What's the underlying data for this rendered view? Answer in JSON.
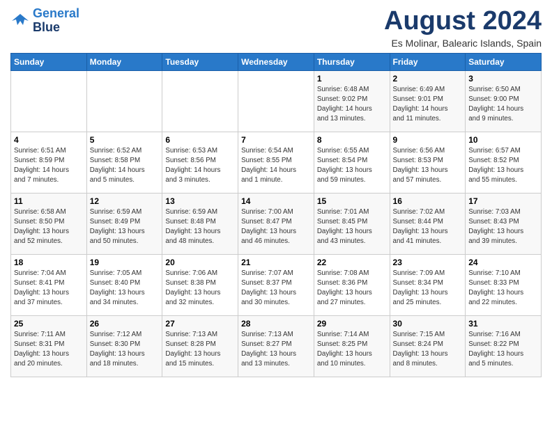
{
  "header": {
    "logo_line1": "General",
    "logo_line2": "Blue",
    "month": "August 2024",
    "location": "Es Molinar, Balearic Islands, Spain"
  },
  "days_of_week": [
    "Sunday",
    "Monday",
    "Tuesday",
    "Wednesday",
    "Thursday",
    "Friday",
    "Saturday"
  ],
  "weeks": [
    [
      {
        "day": "",
        "info": ""
      },
      {
        "day": "",
        "info": ""
      },
      {
        "day": "",
        "info": ""
      },
      {
        "day": "",
        "info": ""
      },
      {
        "day": "1",
        "info": "Sunrise: 6:48 AM\nSunset: 9:02 PM\nDaylight: 14 hours\nand 13 minutes."
      },
      {
        "day": "2",
        "info": "Sunrise: 6:49 AM\nSunset: 9:01 PM\nDaylight: 14 hours\nand 11 minutes."
      },
      {
        "day": "3",
        "info": "Sunrise: 6:50 AM\nSunset: 9:00 PM\nDaylight: 14 hours\nand 9 minutes."
      }
    ],
    [
      {
        "day": "4",
        "info": "Sunrise: 6:51 AM\nSunset: 8:59 PM\nDaylight: 14 hours\nand 7 minutes."
      },
      {
        "day": "5",
        "info": "Sunrise: 6:52 AM\nSunset: 8:58 PM\nDaylight: 14 hours\nand 5 minutes."
      },
      {
        "day": "6",
        "info": "Sunrise: 6:53 AM\nSunset: 8:56 PM\nDaylight: 14 hours\nand 3 minutes."
      },
      {
        "day": "7",
        "info": "Sunrise: 6:54 AM\nSunset: 8:55 PM\nDaylight: 14 hours\nand 1 minute."
      },
      {
        "day": "8",
        "info": "Sunrise: 6:55 AM\nSunset: 8:54 PM\nDaylight: 13 hours\nand 59 minutes."
      },
      {
        "day": "9",
        "info": "Sunrise: 6:56 AM\nSunset: 8:53 PM\nDaylight: 13 hours\nand 57 minutes."
      },
      {
        "day": "10",
        "info": "Sunrise: 6:57 AM\nSunset: 8:52 PM\nDaylight: 13 hours\nand 55 minutes."
      }
    ],
    [
      {
        "day": "11",
        "info": "Sunrise: 6:58 AM\nSunset: 8:50 PM\nDaylight: 13 hours\nand 52 minutes."
      },
      {
        "day": "12",
        "info": "Sunrise: 6:59 AM\nSunset: 8:49 PM\nDaylight: 13 hours\nand 50 minutes."
      },
      {
        "day": "13",
        "info": "Sunrise: 6:59 AM\nSunset: 8:48 PM\nDaylight: 13 hours\nand 48 minutes."
      },
      {
        "day": "14",
        "info": "Sunrise: 7:00 AM\nSunset: 8:47 PM\nDaylight: 13 hours\nand 46 minutes."
      },
      {
        "day": "15",
        "info": "Sunrise: 7:01 AM\nSunset: 8:45 PM\nDaylight: 13 hours\nand 43 minutes."
      },
      {
        "day": "16",
        "info": "Sunrise: 7:02 AM\nSunset: 8:44 PM\nDaylight: 13 hours\nand 41 minutes."
      },
      {
        "day": "17",
        "info": "Sunrise: 7:03 AM\nSunset: 8:43 PM\nDaylight: 13 hours\nand 39 minutes."
      }
    ],
    [
      {
        "day": "18",
        "info": "Sunrise: 7:04 AM\nSunset: 8:41 PM\nDaylight: 13 hours\nand 37 minutes."
      },
      {
        "day": "19",
        "info": "Sunrise: 7:05 AM\nSunset: 8:40 PM\nDaylight: 13 hours\nand 34 minutes."
      },
      {
        "day": "20",
        "info": "Sunrise: 7:06 AM\nSunset: 8:38 PM\nDaylight: 13 hours\nand 32 minutes."
      },
      {
        "day": "21",
        "info": "Sunrise: 7:07 AM\nSunset: 8:37 PM\nDaylight: 13 hours\nand 30 minutes."
      },
      {
        "day": "22",
        "info": "Sunrise: 7:08 AM\nSunset: 8:36 PM\nDaylight: 13 hours\nand 27 minutes."
      },
      {
        "day": "23",
        "info": "Sunrise: 7:09 AM\nSunset: 8:34 PM\nDaylight: 13 hours\nand 25 minutes."
      },
      {
        "day": "24",
        "info": "Sunrise: 7:10 AM\nSunset: 8:33 PM\nDaylight: 13 hours\nand 22 minutes."
      }
    ],
    [
      {
        "day": "25",
        "info": "Sunrise: 7:11 AM\nSunset: 8:31 PM\nDaylight: 13 hours\nand 20 minutes."
      },
      {
        "day": "26",
        "info": "Sunrise: 7:12 AM\nSunset: 8:30 PM\nDaylight: 13 hours\nand 18 minutes."
      },
      {
        "day": "27",
        "info": "Sunrise: 7:13 AM\nSunset: 8:28 PM\nDaylight: 13 hours\nand 15 minutes."
      },
      {
        "day": "28",
        "info": "Sunrise: 7:13 AM\nSunset: 8:27 PM\nDaylight: 13 hours\nand 13 minutes."
      },
      {
        "day": "29",
        "info": "Sunrise: 7:14 AM\nSunset: 8:25 PM\nDaylight: 13 hours\nand 10 minutes."
      },
      {
        "day": "30",
        "info": "Sunrise: 7:15 AM\nSunset: 8:24 PM\nDaylight: 13 hours\nand 8 minutes."
      },
      {
        "day": "31",
        "info": "Sunrise: 7:16 AM\nSunset: 8:22 PM\nDaylight: 13 hours\nand 5 minutes."
      }
    ]
  ]
}
